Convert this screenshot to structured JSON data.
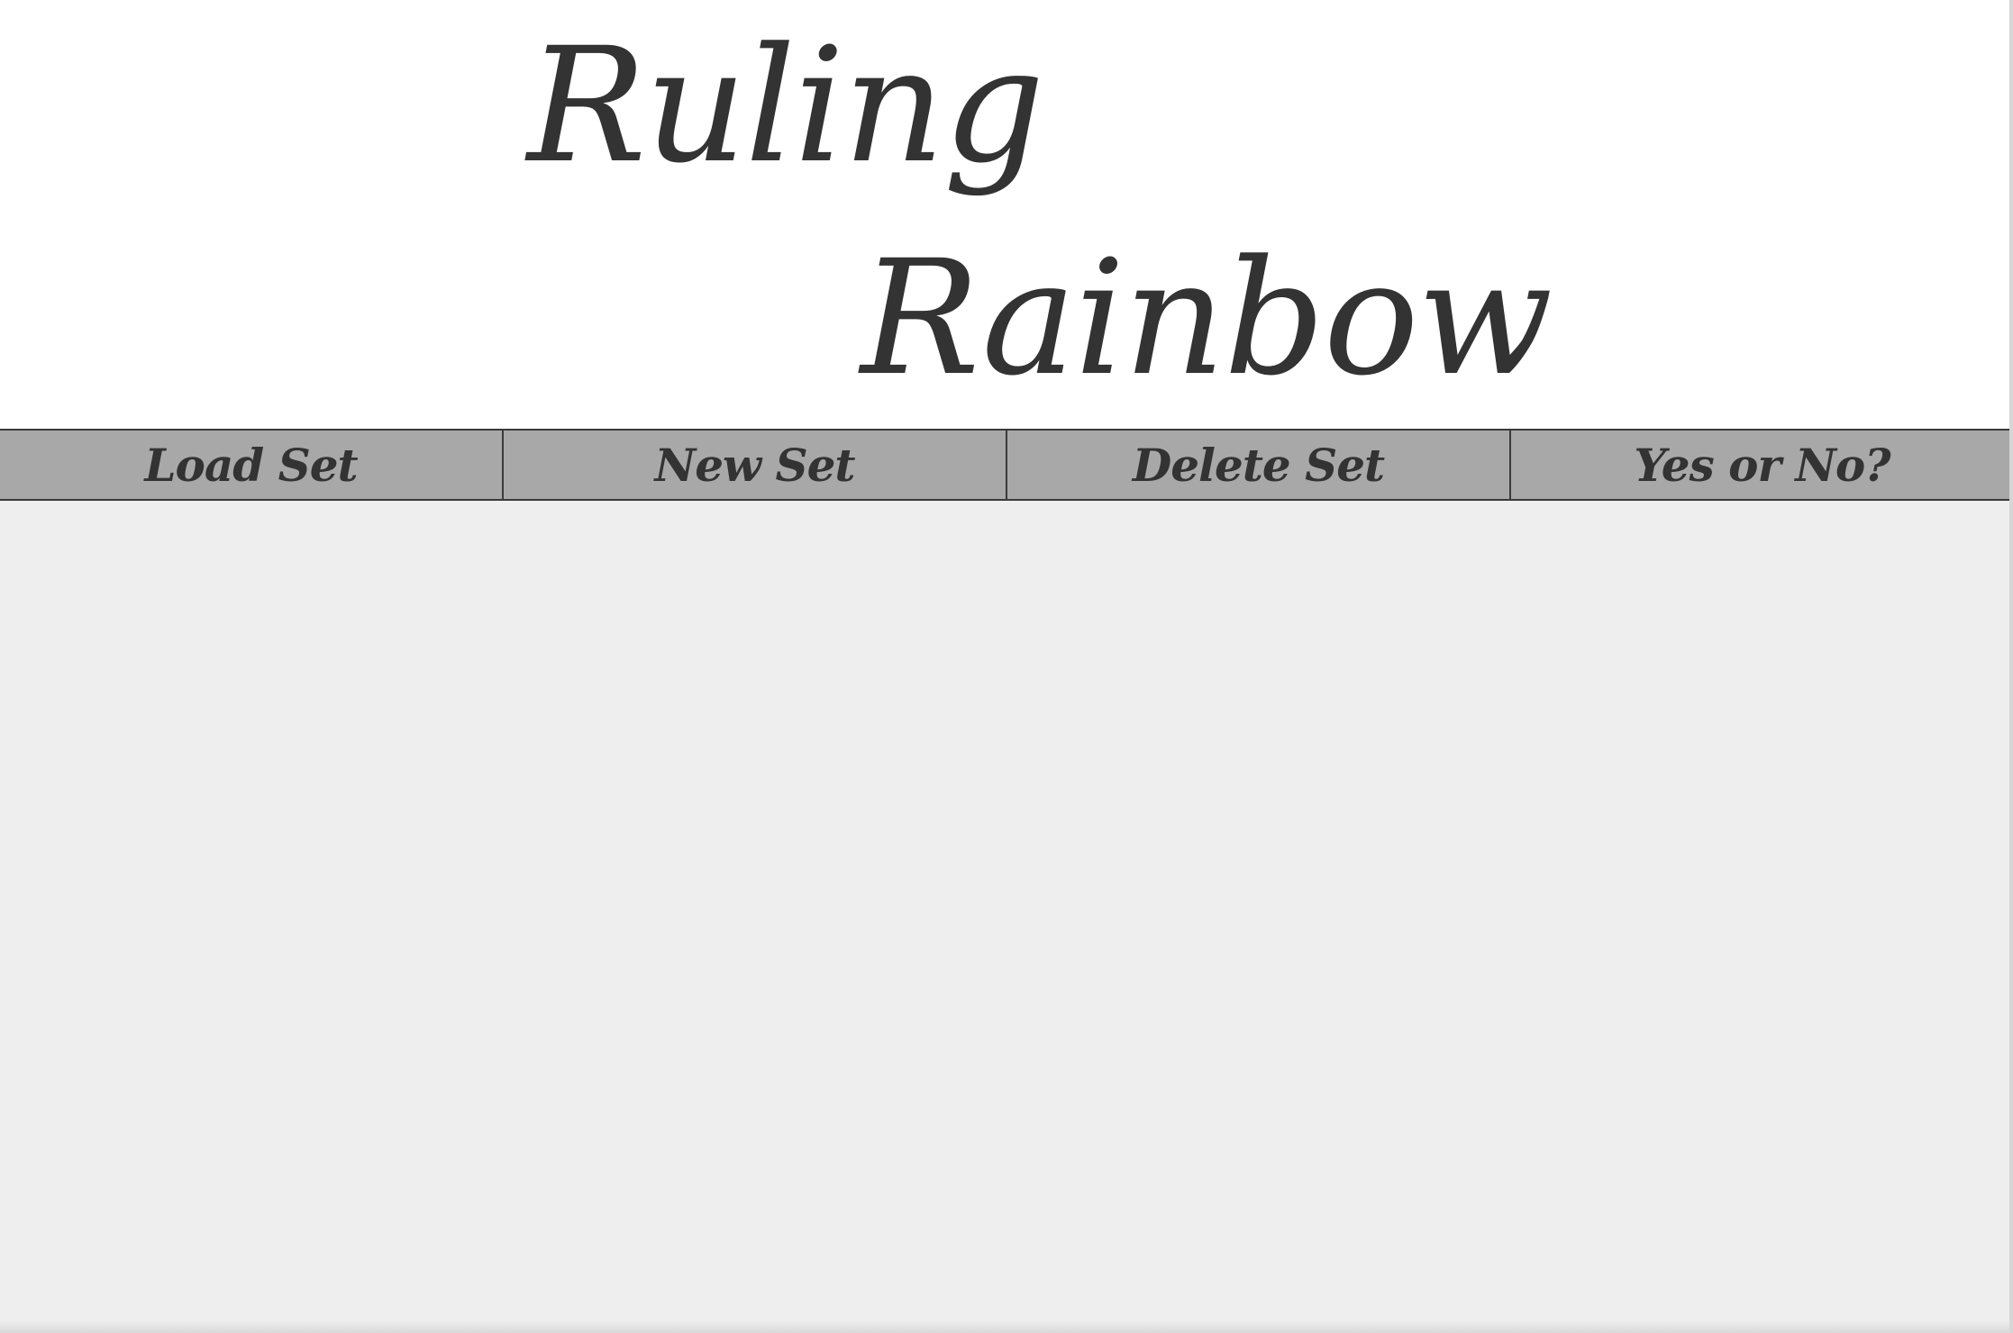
{
  "header": {
    "title_line_1": "Ruling",
    "title_line_2": "Rainbow"
  },
  "nav": {
    "items": [
      {
        "label": "Load Set"
      },
      {
        "label": "New Set"
      },
      {
        "label": "Delete Set"
      },
      {
        "label": "Yes or No?"
      }
    ]
  },
  "colors": {
    "title_text": "#333333",
    "nav_background": "#a8a8a8",
    "nav_border": "#3a3a3a",
    "content_background": "#eeeeee",
    "page_background": "#ffffff"
  }
}
